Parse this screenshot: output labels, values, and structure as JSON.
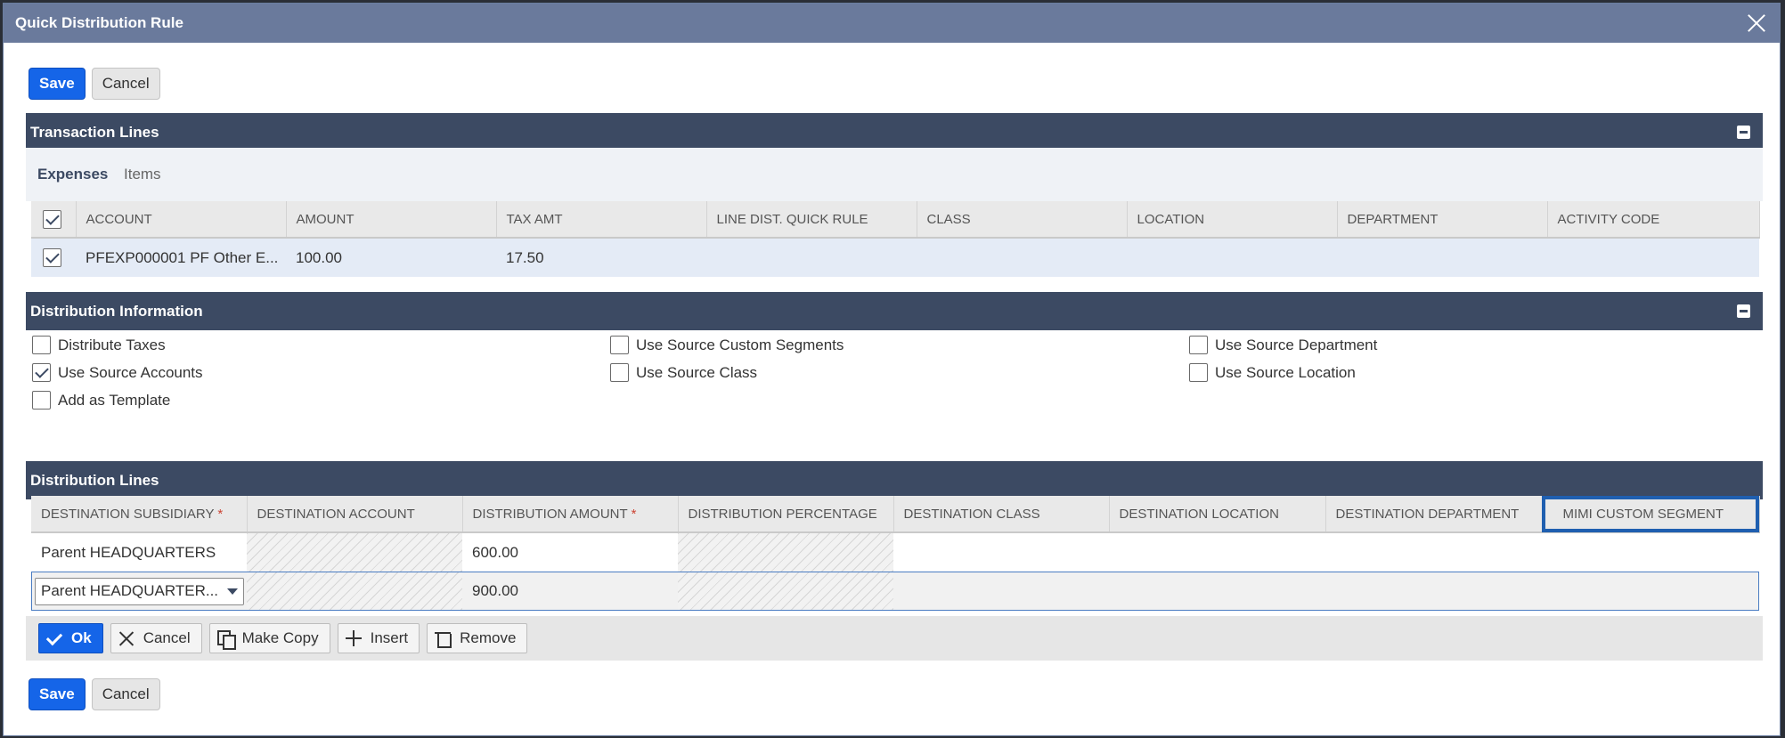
{
  "dialog": {
    "title": "Quick Distribution Rule"
  },
  "buttons": {
    "save": "Save",
    "cancel": "Cancel"
  },
  "transaction_lines": {
    "title": "Transaction Lines",
    "tabs": [
      "Expenses",
      "Items"
    ],
    "columns": [
      "ACCOUNT",
      "AMOUNT",
      "TAX AMT",
      "LINE DIST. QUICK RULE",
      "CLASS",
      "LOCATION",
      "DEPARTMENT",
      "ACTIVITY CODE"
    ],
    "rows": [
      {
        "checked": true,
        "account": "PFEXP000001 PF Other E...",
        "amount": "100.00",
        "tax_amt": "17.50",
        "line_dist": "",
        "class": "",
        "location": "",
        "department": "",
        "activity_code": ""
      }
    ]
  },
  "distribution_info": {
    "title": "Distribution Information",
    "options": {
      "distribute_taxes": {
        "label": "Distribute Taxes",
        "checked": false
      },
      "use_source_accounts": {
        "label": "Use Source Accounts",
        "checked": true
      },
      "add_as_template": {
        "label": "Add as Template",
        "checked": false
      },
      "use_source_custom_segments": {
        "label": "Use Source Custom Segments",
        "checked": false
      },
      "use_source_class": {
        "label": "Use Source Class",
        "checked": false
      },
      "use_source_department": {
        "label": "Use Source Department",
        "checked": false
      },
      "use_source_location": {
        "label": "Use Source Location",
        "checked": false
      }
    }
  },
  "distribution_lines": {
    "title": "Distribution Lines",
    "columns": {
      "dest_subsidiary": "DESTINATION SUBSIDIARY",
      "dest_account": "DESTINATION ACCOUNT",
      "dist_amount": "DISTRIBUTION AMOUNT",
      "dist_percentage": "DISTRIBUTION PERCENTAGE",
      "dest_class": "DESTINATION CLASS",
      "dest_location": "DESTINATION LOCATION",
      "dest_department": "DESTINATION DEPARTMENT",
      "mimi_custom_segment": "MIMI CUSTOM SEGMENT"
    },
    "required_mark": "*",
    "rows": [
      {
        "subsidiary": "Parent HEADQUARTERS",
        "amount": "600.00"
      },
      {
        "subsidiary": "Parent HEADQUARTER...",
        "amount": "900.00"
      }
    ],
    "actions": {
      "ok": "Ok",
      "cancel": "Cancel",
      "make_copy": "Make Copy",
      "insert": "Insert",
      "remove": "Remove"
    }
  },
  "colors": {
    "header_bg": "#3c4a63",
    "title_bg": "#6a7a9c",
    "primary": "#1565e8",
    "highlight_border": "#1f5fb0"
  }
}
